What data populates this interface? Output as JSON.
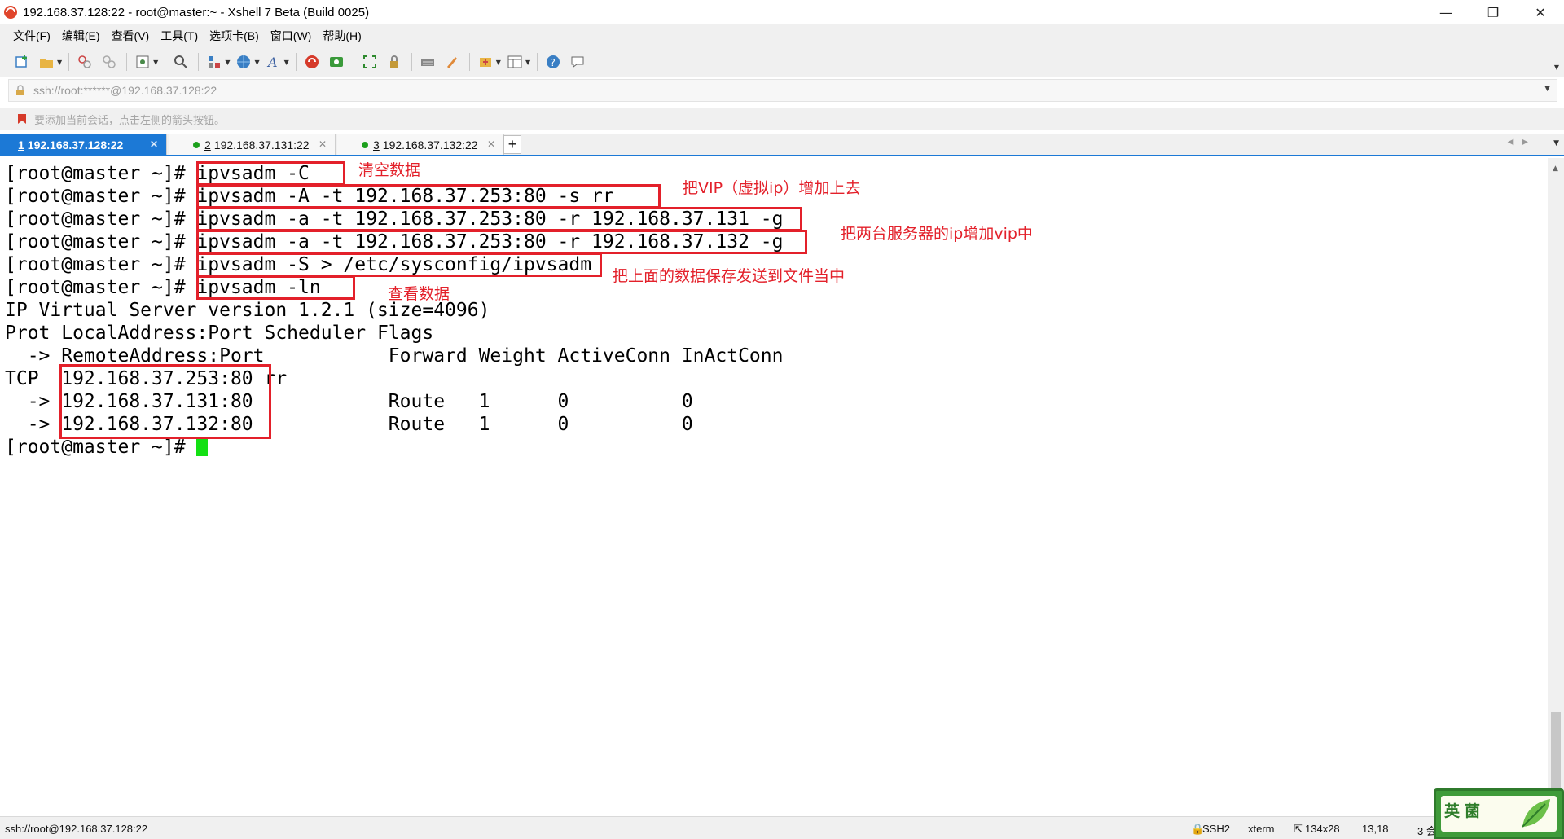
{
  "window": {
    "title": "192.168.37.128:22 - root@master:~ - Xshell 7 Beta (Build 0025)",
    "controls": [
      "minimize-icon",
      "restore-icon",
      "close-icon"
    ]
  },
  "menu": [
    "文件(F)",
    "编辑(E)",
    "查看(V)",
    "工具(T)",
    "选项卡(B)",
    "窗口(W)",
    "帮助(H)"
  ],
  "toolbar": {
    "icons": [
      "new-session-icon",
      "open-folder-icon",
      "connect-icon",
      "disconnect-icon",
      "properties-icon",
      "find-icon",
      "transfer-icon",
      "globe-icon",
      "font-icon",
      "xshell-icon",
      "xftp-icon",
      "fullscreen-icon",
      "lock-icon",
      "keyboard-icon",
      "highlight-icon",
      "compose-icon",
      "layout-icon",
      "help-icon",
      "chat-icon"
    ]
  },
  "address": {
    "text": "ssh://root:******@192.168.37.128:22"
  },
  "session_hint": "要添加当前会话，点击左侧的箭头按钮。",
  "tabs": [
    {
      "num": "1",
      "label": " 192.168.37.128:22",
      "dot": "#1c79d6",
      "active": true
    },
    {
      "num": "2",
      "label": " 192.168.37.131:22",
      "dot": "#1ca01c",
      "active": false
    },
    {
      "num": "3",
      "label": " 192.168.37.132:22",
      "dot": "#1ca01c",
      "active": false
    }
  ],
  "add_tab": "+",
  "terminal": {
    "prompt": "[root@master ~]# ",
    "commands": [
      "ipvsadm -C",
      "ipvsadm -A -t 192.168.37.253:80 -s rr",
      "ipvsadm -a -t 192.168.37.253:80 -r 192.168.37.131 -g",
      "ipvsadm -a -t 192.168.37.253:80 -r 192.168.37.132 -g",
      "ipvsadm -S > /etc/sysconfig/ipvsadm",
      "ipvsadm -ln"
    ],
    "output": [
      "IP Virtual Server version 1.2.1 (size=4096)",
      "Prot LocalAddress:Port Scheduler Flags",
      "  -> RemoteAddress:Port           Forward Weight ActiveConn InActConn",
      "TCP  192.168.37.253:80 rr",
      "  -> 192.168.37.131:80            Route   1      0          0",
      "  -> 192.168.37.132:80            Route   1      0          0"
    ],
    "last_prompt": "[root@master ~]# "
  },
  "annotations": [
    "清空数据",
    "把VIP（虚拟ip）增加上去",
    "把两台服务器的ip增加vip中",
    "把上面的数据保存发送到文件当中",
    "查看数据"
  ],
  "colors": {
    "annotation": "#e3202a",
    "tab_active": "#1c79d6",
    "cursor": "#13e013"
  },
  "status": {
    "path": "ssh://root@192.168.37.128:22",
    "protocol": "SSH2",
    "term": "xterm",
    "size": "134x28",
    "position": "13,18",
    "sessions": "3 会"
  },
  "logo_text": "英菌"
}
